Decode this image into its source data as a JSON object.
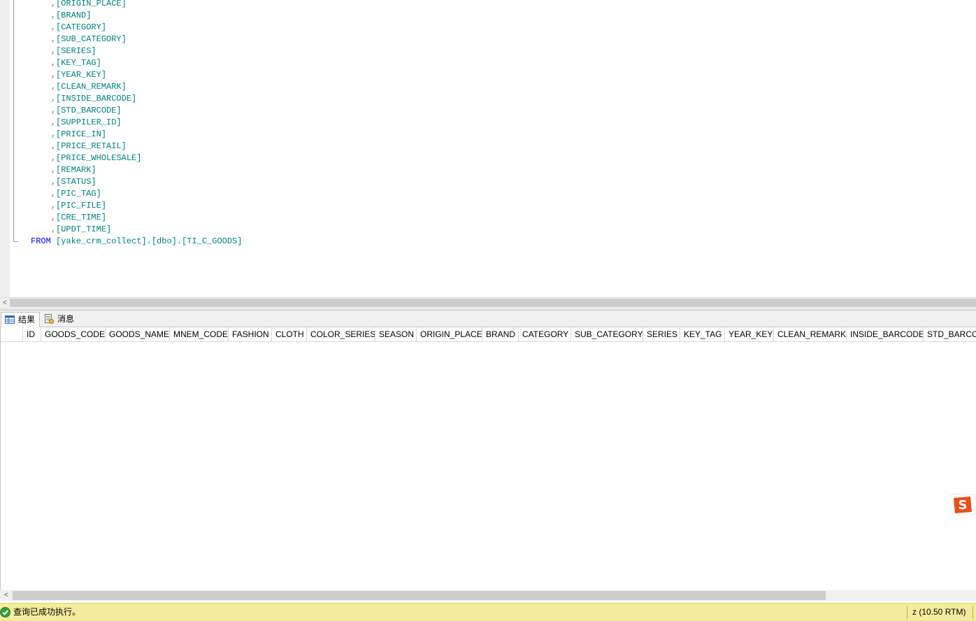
{
  "editor": {
    "columns": [
      "[ORIGIN_PLACE]",
      "[BRAND]",
      "[CATEGORY]",
      "[SUB_CATEGORY]",
      "[SERIES]",
      "[KEY_TAG]",
      "[YEAR_KEY]",
      "[CLEAN_REMARK]",
      "[INSIDE_BARCODE]",
      "[STD_BARCODE]",
      "[SUPPILER_ID]",
      "[PRICE_IN]",
      "[PRICE_RETAIL]",
      "[PRICE_WHOLESALE]",
      "[REMARK]",
      "[STATUS]",
      "[PIC_TAG]",
      "[PIC_FILE]",
      "[CRE_TIME]",
      "[UPDT_TIME]"
    ],
    "comma": ",",
    "from_keyword": "FROM",
    "from_table": "[yake_crm_collect].[dbo].[TI_C_GOODS]"
  },
  "scrollbar_arrow": "<",
  "tabs": {
    "results": "结果",
    "messages": "消息"
  },
  "grid": {
    "columns": [
      "ID",
      "GOODS_CODE",
      "GOODS_NAME",
      "MNEM_CODE",
      "FASHION",
      "CLOTH",
      "COLOR_SERIES",
      "SEASON",
      "ORIGIN_PLACE",
      "BRAND",
      "CATEGORY",
      "SUB_CATEGORY",
      "SERIES",
      "KEY_TAG",
      "YEAR_KEY",
      "CLEAN_REMARK",
      "INSIDE_BARCODE",
      "STD_BARCODE"
    ],
    "rows": []
  },
  "status": {
    "message": "查询已成功执行。",
    "server": "z (10.50 RTM)"
  },
  "colors": {
    "identifier": "#008080",
    "keyword": "#0000ff",
    "status_bg": "#f4ec9d"
  }
}
